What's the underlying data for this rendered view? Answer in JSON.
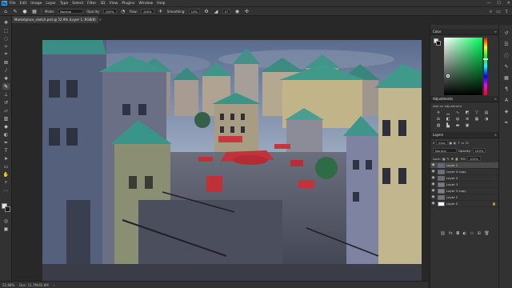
{
  "app": {
    "logo": "Ps",
    "menu": [
      "File",
      "Edit",
      "Image",
      "Layer",
      "Type",
      "Select",
      "Filter",
      "3D",
      "View",
      "Plugins",
      "Window",
      "Help"
    ],
    "window_controls": [
      "—",
      "☐",
      "✕"
    ]
  },
  "options": {
    "mode_label": "Mode:",
    "mode_value": "Normal",
    "opacity_label": "Opacity:",
    "opacity_value": "100%",
    "flow_label": "Flow:",
    "flow_value": "100%",
    "smoothing_label": "Smoothing:",
    "smoothing_value": "10%",
    "angle_value": "0°"
  },
  "document": {
    "tab_title": "Marketplace_sketch.psd @ 52.9% (Layer 1, RGB/8)",
    "close": "×"
  },
  "status": {
    "zoom": "52.88%",
    "doc_info": "Doc: 11.7M/45.6M"
  },
  "panels": {
    "color_title": "Color",
    "adjustments_title": "Adjustments",
    "adjustments_hint": "Add an adjustment",
    "layers_title": "Layers",
    "kind_label": "Kind",
    "blend_mode": "Normal",
    "opacity_label": "Opacity:",
    "opacity_value": "100%",
    "lock_label": "Lock:",
    "fill_label": "Fill:",
    "fill_value": "100%",
    "layers": [
      {
        "name": "Layer 1",
        "selected": true
      },
      {
        "name": "Layer 4 copy"
      },
      {
        "name": "Layer 4"
      },
      {
        "name": "Layer 3"
      },
      {
        "name": "Layer 3 copy"
      },
      {
        "name": "Layer 2"
      },
      {
        "name": "Layer 0"
      }
    ]
  },
  "colors": {
    "accent": "#31a8ff",
    "chrome": "#323232",
    "canvas_bg": "#282828"
  }
}
